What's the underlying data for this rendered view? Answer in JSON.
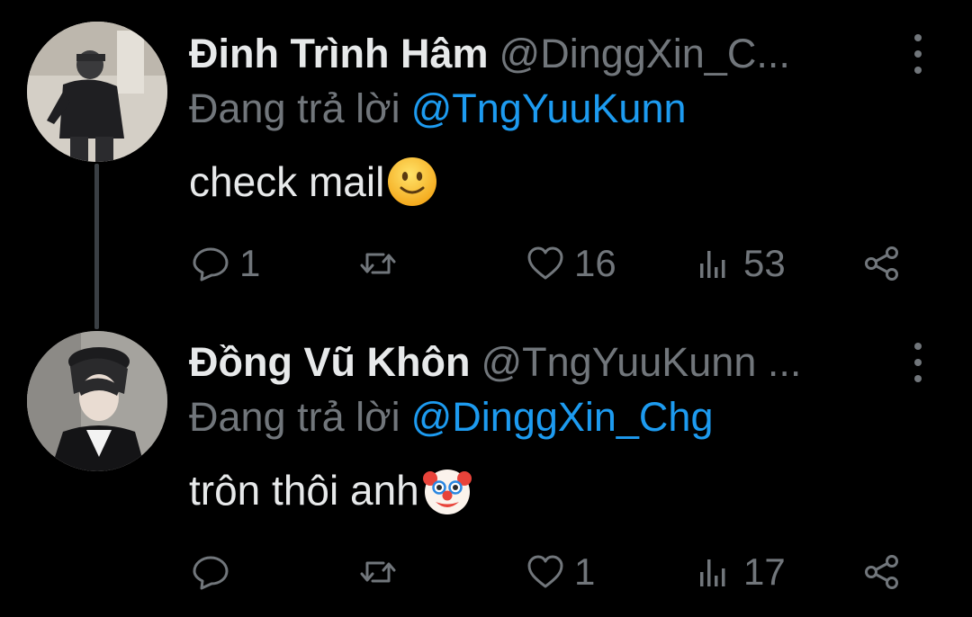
{
  "tweets": [
    {
      "author_name": "Đinh Trình Hâm",
      "handle": "@DinggXin_C...",
      "reply_prefix": "Đang trả lời",
      "reply_to": "@TngYuuKunn",
      "text": "check mail",
      "emoji": "slightly-smiling-face",
      "replies": "1",
      "retweets": "",
      "likes": "16",
      "views": "53"
    },
    {
      "author_name": "Đồng Vũ Khôn",
      "handle": "@TngYuuKunn ...",
      "reply_prefix": "Đang trả lời",
      "reply_to": "@DinggXin_Chg",
      "text": "trôn thôi anh",
      "emoji": "clown-face",
      "replies": "",
      "retweets": "",
      "likes": "1",
      "views": "17"
    }
  ],
  "colors": {
    "background": "#000000",
    "primary_text": "#e7e9ea",
    "secondary_text": "#71767b",
    "link": "#1d9bf0",
    "thread_line": "#3a3f44"
  }
}
